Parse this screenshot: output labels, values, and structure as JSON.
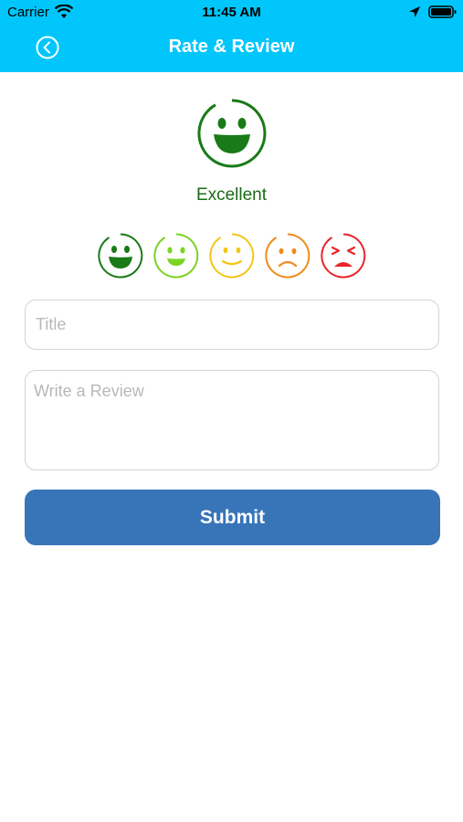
{
  "status_bar": {
    "carrier": "Carrier",
    "time": "11:45 AM"
  },
  "nav": {
    "title": "Rate & Review",
    "back_icon": "chevron-left-circle-icon"
  },
  "rating": {
    "selected_label": "Excellent",
    "options": [
      {
        "name": "excellent",
        "color": "#1a7a17"
      },
      {
        "name": "good",
        "color": "#7bd322"
      },
      {
        "name": "okay",
        "color": "#f5c518"
      },
      {
        "name": "bad",
        "color": "#f08a1c"
      },
      {
        "name": "terrible",
        "color": "#e8262a"
      }
    ]
  },
  "form": {
    "title_placeholder": "Title",
    "review_placeholder": "Write a Review",
    "submit_label": "Submit"
  },
  "colors": {
    "header": "#00c6fb",
    "button": "#3874b8",
    "selected_face": "#1a6b16"
  }
}
